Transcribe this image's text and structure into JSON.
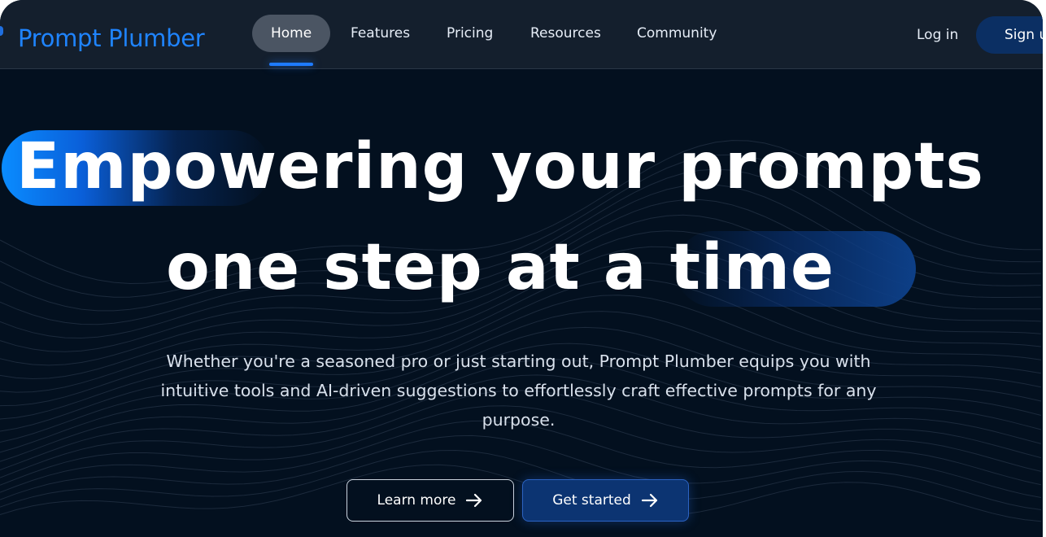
{
  "brand": {
    "name": "Prompt Plumber",
    "color": "#1f84ff"
  },
  "nav": {
    "items": [
      {
        "label": "Home",
        "active": true
      },
      {
        "label": "Features",
        "active": false
      },
      {
        "label": "Pricing",
        "active": false
      },
      {
        "label": "Resources",
        "active": false
      },
      {
        "label": "Community",
        "active": false
      }
    ],
    "login_label": "Log in",
    "signup_label": "Sign u"
  },
  "hero": {
    "headline_line1": "Empowering your prompts",
    "headline_line2": "one step at a time",
    "subtext": "Whether you're a seasoned pro or just starting out, Prompt Plumber equips you with intuitive tools and AI-driven suggestions to effortlessly craft effective prompts for any purpose.",
    "learn_more_label": "Learn more",
    "get_started_label": "Get started",
    "arrow_icon": "arrow-right-icon"
  },
  "colors": {
    "background": "#03101f",
    "nav_background": "#141f2d",
    "accent": "#1e7bff",
    "primary_button": "#0c3472"
  }
}
